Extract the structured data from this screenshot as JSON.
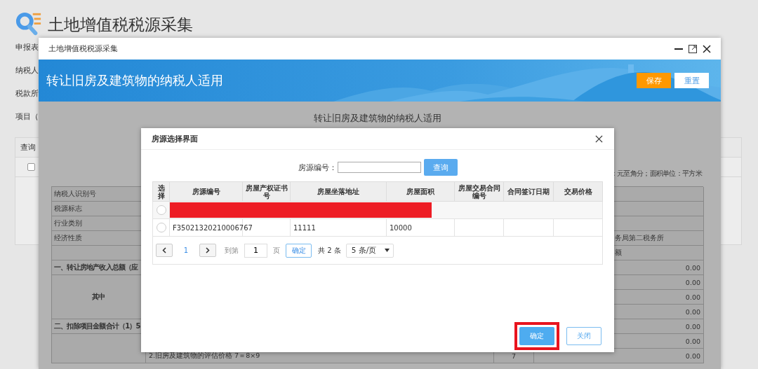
{
  "page": {
    "title": "土地增值税税源采集",
    "labels": [
      "申报表",
      "纳税人",
      "税款所",
      "项目（"
    ],
    "query_panel": {
      "title": "查询",
      "checked": false
    }
  },
  "window": {
    "title": "土地增值税税源采集",
    "banner_title": "转让旧房及建筑物的纳税人适用",
    "buttons": [
      {
        "label": "保存",
        "kind": "primary"
      },
      {
        "label": "重置",
        "kind": "secondary"
      }
    ]
  },
  "form": {
    "title": "转让旧房及建筑物的纳税人适用",
    "units_note": "：元至角分；面积单位：平方米",
    "rows": [
      {
        "label": "纳税人识别号",
        "bold": false
      },
      {
        "label": "税源标志",
        "bold": false
      },
      {
        "label": "行业类别",
        "bold": false
      },
      {
        "label": "经济性质",
        "bold": false,
        "lines": [
          {
            "note": "务局第二税务所"
          }
        ]
      },
      {
        "lines": [
          {
            "note": "额"
          }
        ]
      },
      {
        "label": "一、转让房地产收入总额（应",
        "bold": true,
        "lines": [
          {
            "amount": "0.00"
          }
        ]
      },
      {
        "label": "其中",
        "bold": true,
        "lines": [
          {
            "amount": "0.00"
          },
          {
            "amount": "0.00"
          },
          {
            "amount": "0.00"
          }
        ]
      },
      {
        "label": "二、扣除项目金额合计（1）5",
        "bold": true,
        "lines": [
          {
            "amount": "0.00"
          }
        ]
      },
      {
        "lines": [
          {
            "amount": "0.00"
          },
          {
            "item": "2.旧房及建筑物的评估价格 7＝8×9",
            "line_no": "7",
            "amount": "0.00"
          }
        ]
      }
    ]
  },
  "dialog": {
    "title": "房源选择界面",
    "search": {
      "label": "房源编号：",
      "button": "查询"
    },
    "columns": [
      "选择",
      "房源编号",
      "房屋产权证书号",
      "房屋坐落地址",
      "房屋面积",
      "房屋交易合同编号",
      "合同签订日期",
      "交易价格"
    ],
    "rows": [
      {
        "selected": false,
        "redacted": true
      },
      {
        "selected": false,
        "redacted": false,
        "house_id": "F35021320210006767",
        "address": "11111",
        "area": "10000"
      }
    ],
    "pager": {
      "page": "1",
      "goto_label": "到第",
      "goto_value": "1",
      "page_unit": "页",
      "go_button": "确定",
      "total": "共 2 条",
      "page_size": "5 条/页"
    },
    "buttons": [
      {
        "label": "确定",
        "kind": "primary",
        "highlighted": true
      },
      {
        "label": "关闭",
        "kind": "secondary",
        "highlighted": false
      }
    ]
  }
}
